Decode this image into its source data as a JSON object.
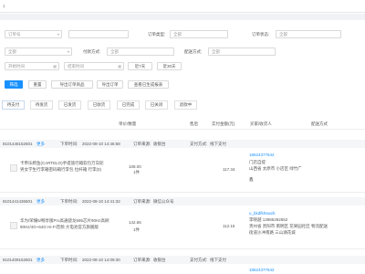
{
  "filters": {
    "order_no_placeholder": "订单号",
    "order_type_label": "订单类型:",
    "order_type_value": "全部",
    "order_status_label": "订单状态:",
    "order_status_value": "全部",
    "region_value": "全部",
    "pay_method_label": "付款方式:",
    "pay_method_value": "全部",
    "delivery_method_label": "配送方式:",
    "delivery_method_value": "全部",
    "start_time_placeholder": "开始时间",
    "end_time_placeholder": "结束时间",
    "last7_label": "近7天",
    "last30_label": "近30天"
  },
  "actions": {
    "search": "筛选",
    "reset": "重置",
    "export_items": "导出订单商品",
    "export_orders": "导出订单",
    "view_exported": "查看已生成报表"
  },
  "status_tabs": [
    "待支付",
    "待发货",
    "已发货",
    "已收货",
    "已完成",
    "已关闭",
    "退款中"
  ],
  "table_headers": [
    "单价/数量",
    "售后",
    "实付金额(元)",
    "买家/收货人",
    "配送方式"
  ],
  "orders": [
    {
      "order_no": "8101446152601",
      "more": "更多",
      "order_time_label": "下单时间:",
      "order_time": "2022-08-10 14:46:58",
      "source_label": "订单来源:",
      "source": "收银台",
      "pay_label": "支付方式:",
      "pay": "线下支付",
      "product_line1": "卡帝乐鳄鱼(CARTELO)手提旅行箱软包万向轮",
      "product_line2": "男女学生行李箱密码箱行李包 拉杆箱 行李(0)",
      "price": "108.00",
      "qty": "1件",
      "paid": "117.34",
      "buyer_phone": "18624377642",
      "buyer_line2": "门店自提",
      "buyer_line3": "山西省 太原市 小店区 绿竹广",
      "buyer_line4": "鑫",
      "delivery": ""
    },
    {
      "order_no": "8101441436501",
      "more": "更多",
      "order_time_label": "下单时间:",
      "order_time": "2022-08-10 14:41:32",
      "source_label": "订单来源:",
      "source": "微信公众号",
      "pay_label": "",
      "pay": "",
      "product_line1": "华为/荣耀5/畅享版Pro高通骁龙695芯片90Hz高刷",
      "product_line2": "90Hz/4G+64G Hi-Fi音频 大电池官方旗舰版",
      "price": "142.65",
      "qty": "1件",
      "paid": "112.15",
      "buyer_phone": "u_bkdfkhswzb",
      "buyer_line2": "李晓越   13985292652",
      "buyer_line3": "贵州省 贵阳市 南明区 花果园社区",
      "buyer_line4": "街道沙冲南路 三山湖花城",
      "delivery": "物流配送"
    },
    {
      "order_no": "8101409152601",
      "more": "更多",
      "order_time_label": "下单时间:",
      "order_time": "2022-08-10 14:09:30",
      "source_label": "订单来源:",
      "source": "收银台",
      "pay_label": "支付方式:",
      "pay": "线下支付",
      "buyer_phone": "18624377642"
    }
  ]
}
